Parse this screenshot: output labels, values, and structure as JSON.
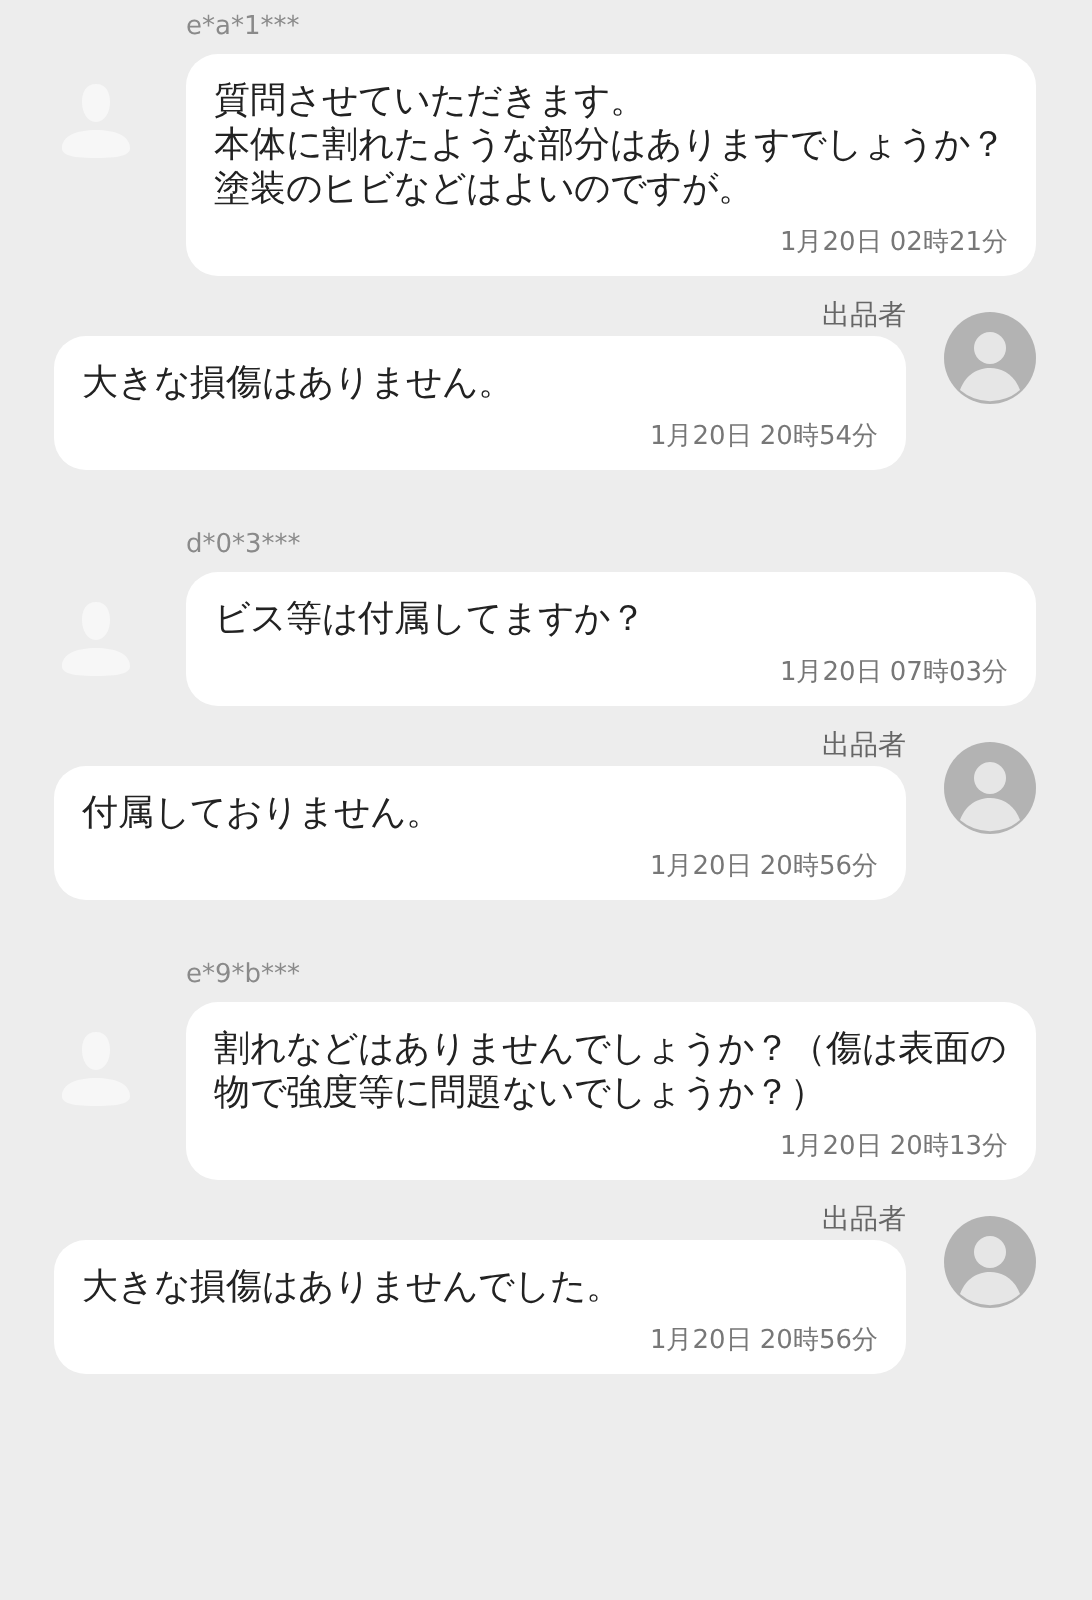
{
  "messages": [
    {
      "kind": "buyer",
      "author": "e*a*1***",
      "lines": [
        "質問させていただきます。",
        "本体に割れたような部分はありますでしょうか？",
        "塗装のヒビなどはよいのですが。"
      ],
      "time": "1月20日 02時21分"
    },
    {
      "kind": "seller",
      "author": "出品者",
      "lines": [
        "大きな損傷はありません。"
      ],
      "time": "1月20日 20時54分"
    },
    {
      "kind": "buyer",
      "author": "d*0*3***",
      "lines": [
        "ビス等は付属してますか？"
      ],
      "time": "1月20日 07時03分"
    },
    {
      "kind": "seller",
      "author": "出品者",
      "lines": [
        "付属しておりません。"
      ],
      "time": "1月20日 20時56分"
    },
    {
      "kind": "buyer",
      "author": "e*9*b***",
      "lines": [
        "割れなどはありませんでしょうか？（傷は表面の物で強度等に問題ないでしょうか？）"
      ],
      "time": "1月20日 20時13分"
    },
    {
      "kind": "seller",
      "author": "出品者",
      "lines": [
        "大きな損傷はありませんでした。"
      ],
      "time": "1月20日 20時56分"
    }
  ]
}
